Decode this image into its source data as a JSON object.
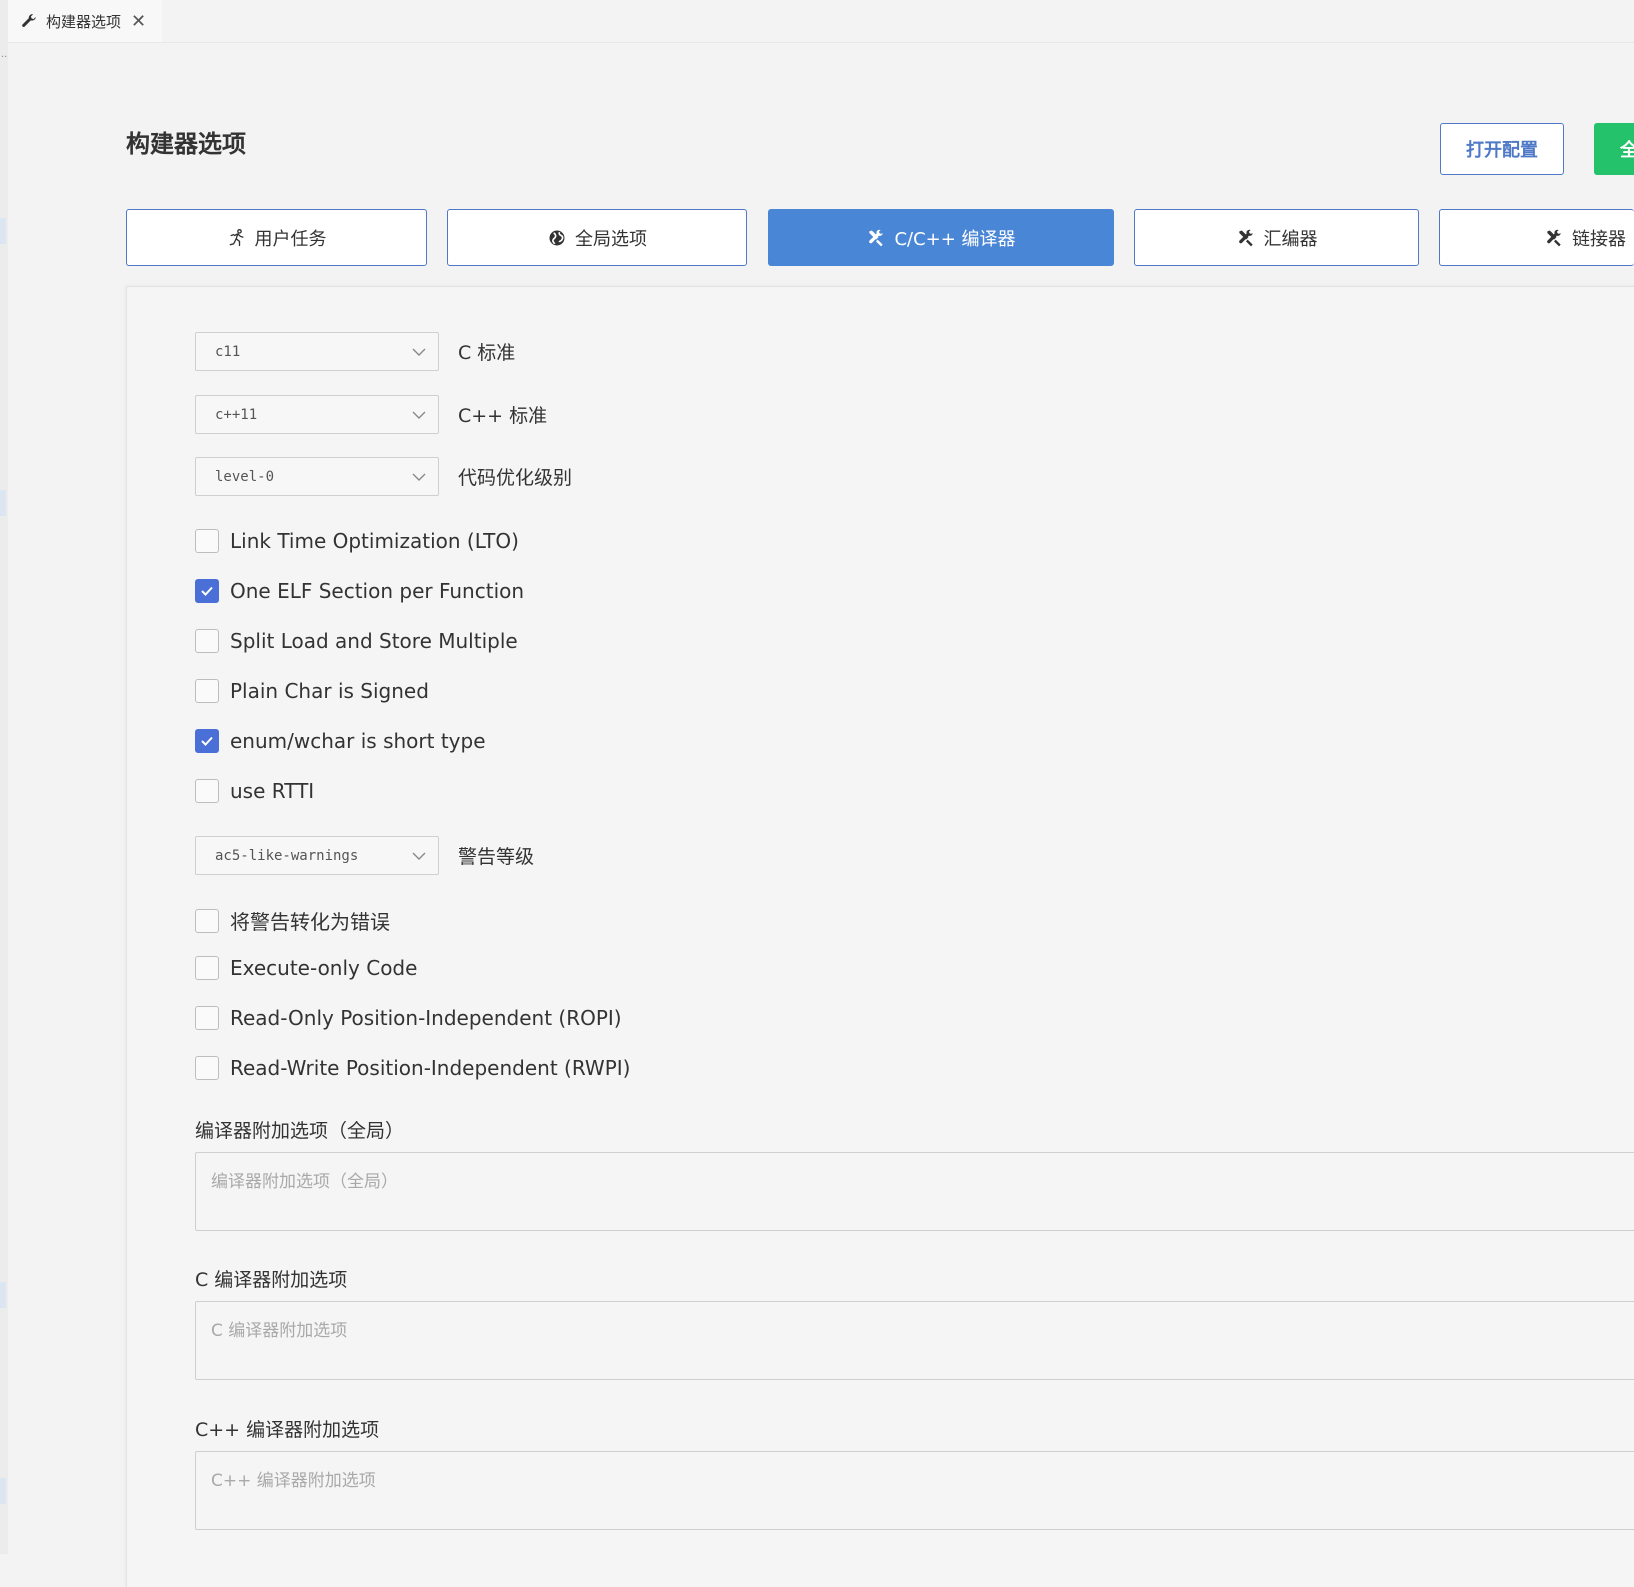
{
  "editor_tab": {
    "title": "构建器选项",
    "icon": "wrench-icon",
    "close_icon": "close-icon"
  },
  "header": {
    "title": "构建器选项",
    "open_config_label": "打开配置",
    "green_button_label": "全"
  },
  "section_tabs": [
    {
      "label": "用户任务",
      "icon": "run-icon",
      "active": false
    },
    {
      "label": "全局选项",
      "icon": "globe-icon",
      "active": false
    },
    {
      "label": "C/C++ 编译器",
      "icon": "tools-icon",
      "active": true
    },
    {
      "label": "汇编器",
      "icon": "tools-icon",
      "active": false
    },
    {
      "label": "链接器",
      "icon": "tools-icon",
      "active": false
    }
  ],
  "compiler": {
    "c_standard": {
      "value": "c11",
      "label": "C 标准"
    },
    "cpp_standard": {
      "value": "c++11",
      "label": "C++ 标准"
    },
    "optimization": {
      "value": "level-0",
      "label": "代码优化级别"
    },
    "options": [
      {
        "label": "Link Time Optimization (LTO)",
        "checked": false
      },
      {
        "label": "One ELF Section per Function",
        "checked": true
      },
      {
        "label": "Split Load and Store Multiple",
        "checked": false
      },
      {
        "label": "Plain Char is Signed",
        "checked": false
      },
      {
        "label": "enum/wchar is short type",
        "checked": true
      },
      {
        "label": "use RTTI",
        "checked": false
      }
    ],
    "warnings": {
      "value": "ac5-like-warnings",
      "label": "警告等级"
    },
    "options2": [
      {
        "label": "将警告转化为错误",
        "checked": false
      },
      {
        "label": "Execute-only Code",
        "checked": false
      },
      {
        "label": "Read-Only Position-Independent (ROPI)",
        "checked": false
      },
      {
        "label": "Read-Write Position-Independent (RWPI)",
        "checked": false
      }
    ],
    "global_extra": {
      "label": "编译器附加选项（全局）",
      "placeholder": "编译器附加选项（全局）"
    },
    "c_extra": {
      "label": "C 编译器附加选项",
      "placeholder": "C 编译器附加选项"
    },
    "cpp_extra": {
      "label": "C++ 编译器附加选项",
      "placeholder": "C++ 编译器附加选项"
    }
  },
  "colors": {
    "accent": "#4a86d6",
    "checkbox": "#4a6fd6",
    "green": "#23c26b",
    "border_blue": "#4f79c7"
  }
}
